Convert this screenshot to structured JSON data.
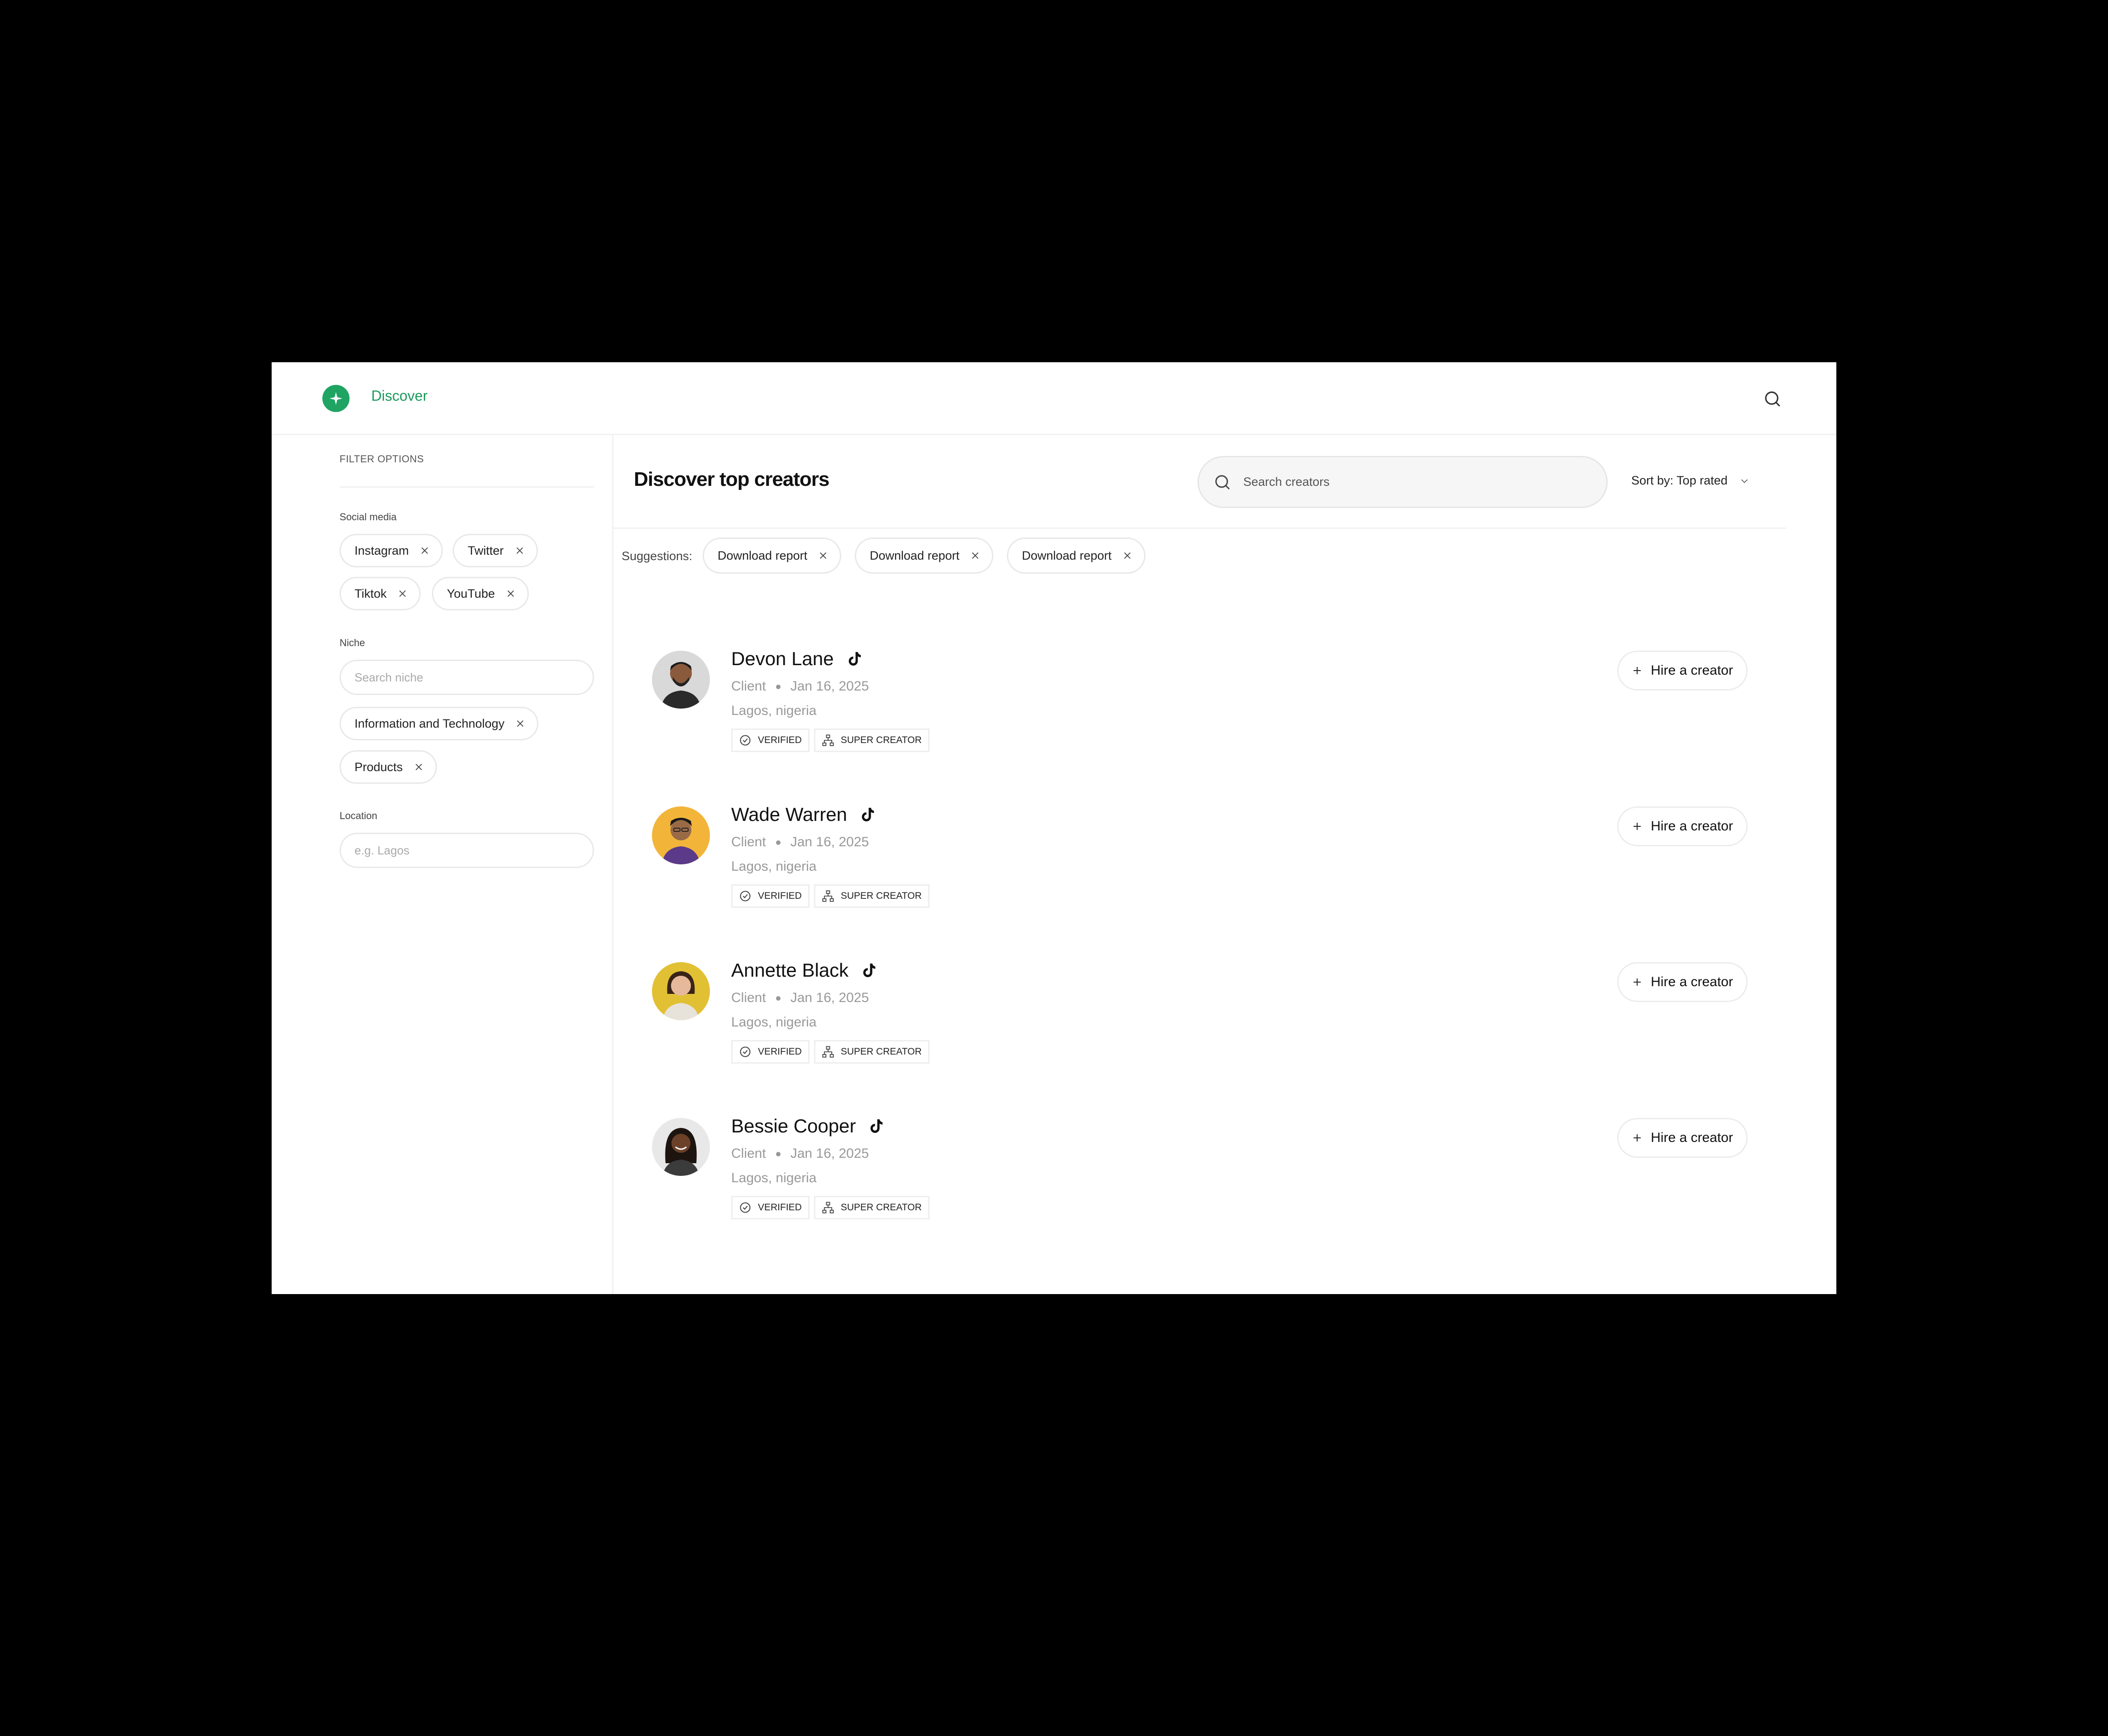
{
  "app": {
    "brand": "Discover",
    "accent": "#1fa463"
  },
  "sidebar": {
    "title": "FILTER OPTIONS",
    "social_media": {
      "label": "Social media",
      "chips": [
        "Instagram",
        "Twitter",
        "Tiktok",
        "YouTube"
      ]
    },
    "niche": {
      "label": "Niche",
      "placeholder": "Search niche",
      "chips": [
        "Information and Technology",
        "Products"
      ]
    },
    "location": {
      "label": "Location",
      "placeholder": "e.g. Lagos"
    }
  },
  "main": {
    "title": "Discover top creators",
    "search_placeholder": "Search creators",
    "sort_label": "Sort by: Top rated",
    "suggestions": {
      "label": "Suggestions:",
      "chips": [
        "Download report",
        "Download report",
        "Download report"
      ]
    },
    "creators": [
      {
        "name": "Devon Lane",
        "role": "Client",
        "date": "Jan 16, 2025",
        "location": "Lagos, nigeria",
        "badges": [
          "VERIFIED",
          "SUPER CREATOR"
        ],
        "action": "Hire a creator",
        "platform_icon": "tiktok-icon"
      },
      {
        "name": "Wade Warren",
        "role": "Client",
        "date": "Jan 16, 2025",
        "location": "Lagos, nigeria",
        "badges": [
          "VERIFIED",
          "SUPER CREATOR"
        ],
        "action": "Hire a creator",
        "platform_icon": "tiktok-icon"
      },
      {
        "name": "Annette Black",
        "role": "Client",
        "date": "Jan 16, 2025",
        "location": "Lagos, nigeria",
        "badges": [
          "VERIFIED",
          "SUPER CREATOR"
        ],
        "action": "Hire a creator",
        "platform_icon": "tiktok-icon"
      },
      {
        "name": "Bessie Cooper",
        "role": "Client",
        "date": "Jan 16, 2025",
        "location": "Lagos, nigeria",
        "badges": [
          "VERIFIED",
          "SUPER CREATOR"
        ],
        "action": "Hire a creator",
        "platform_icon": "tiktok-icon"
      }
    ]
  }
}
